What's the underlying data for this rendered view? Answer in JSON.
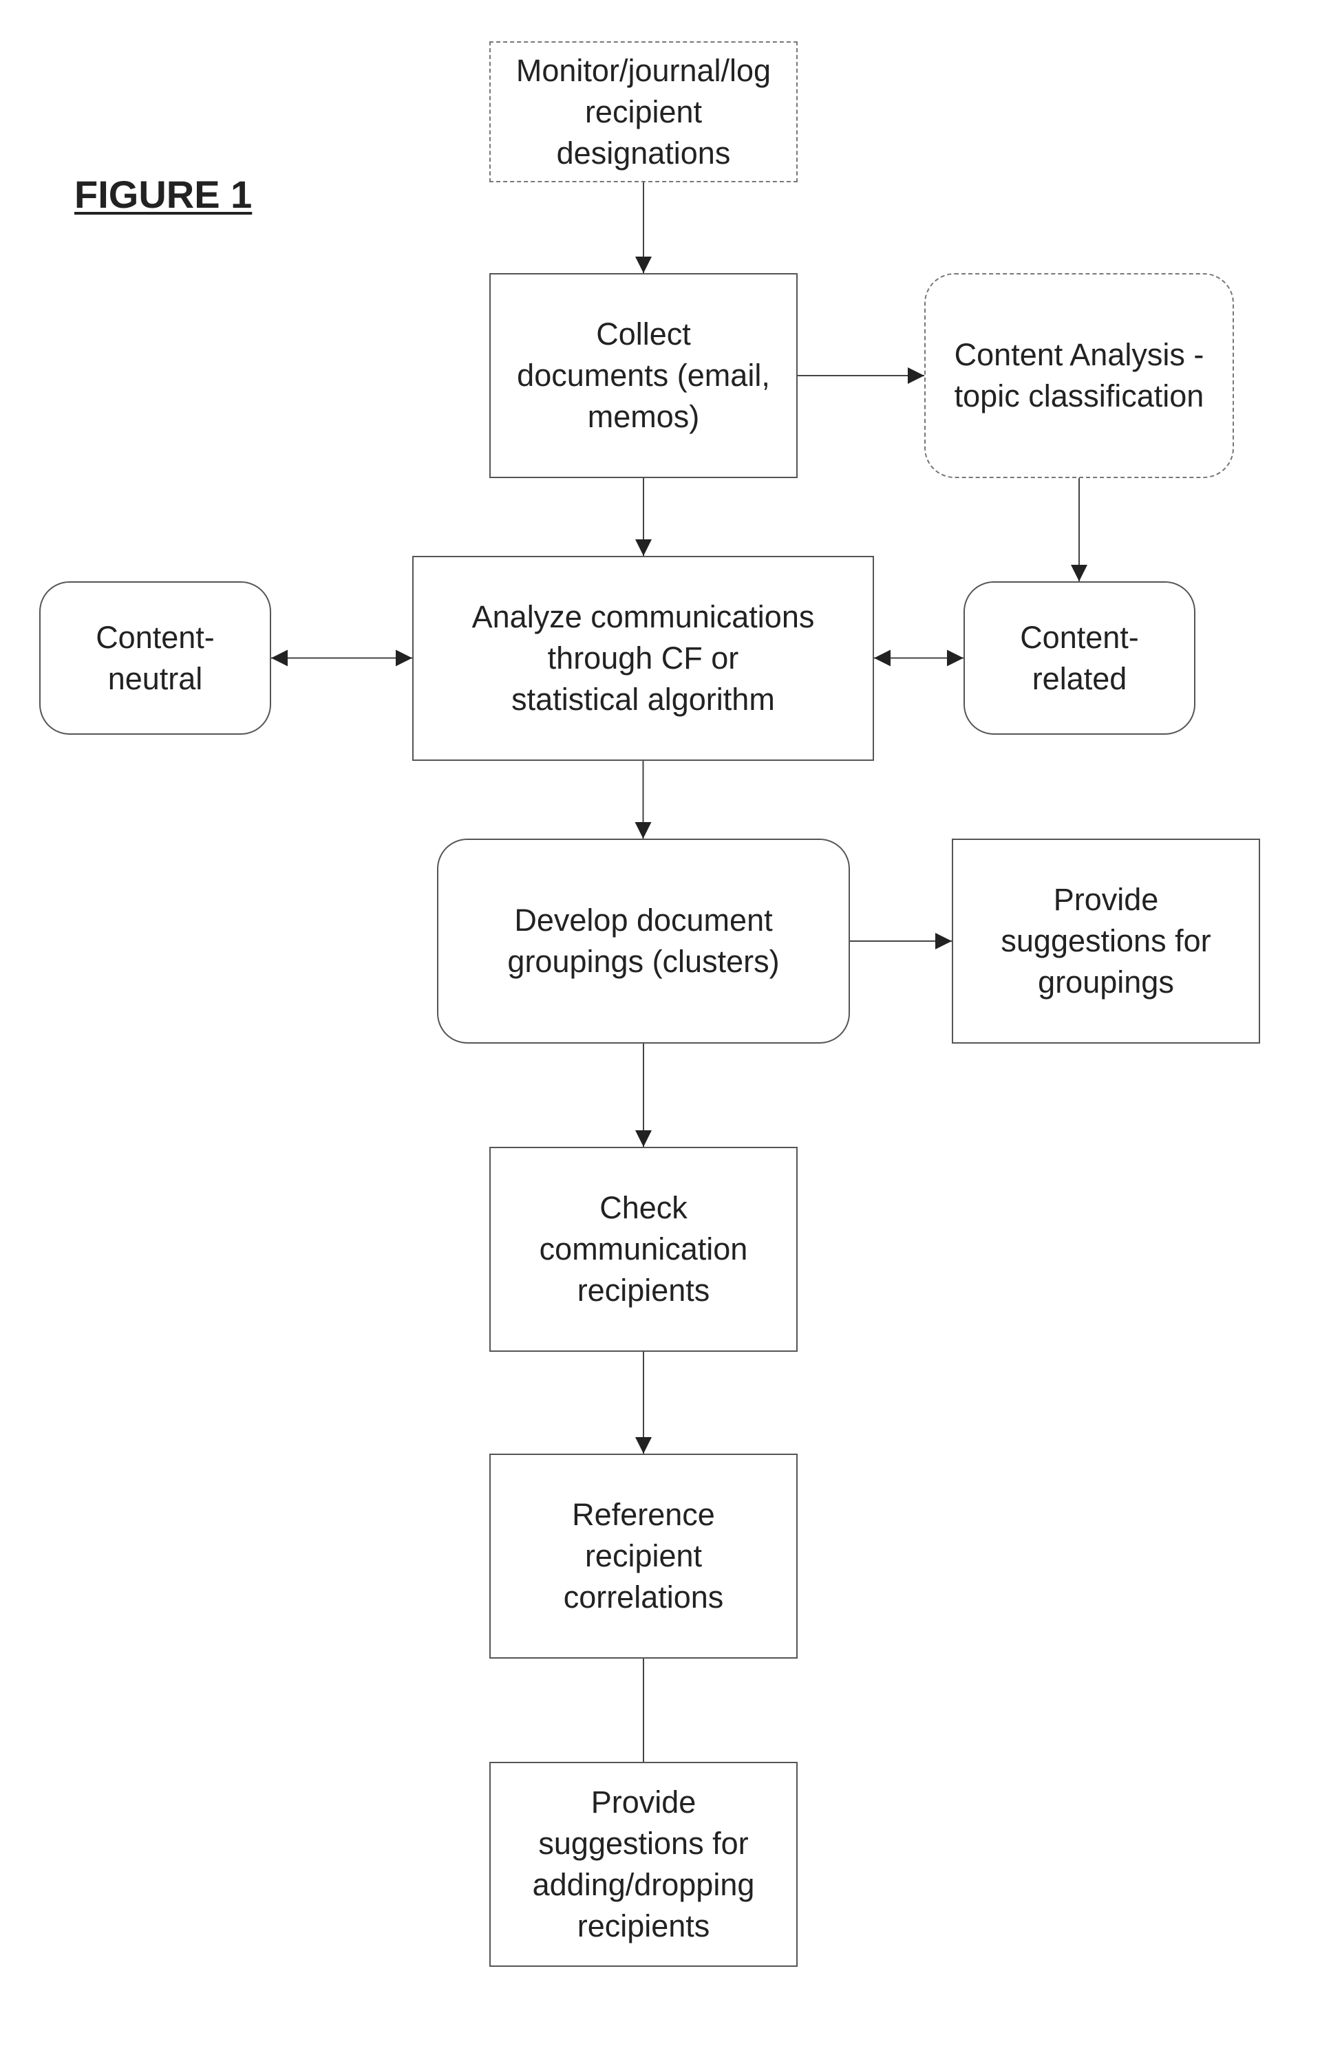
{
  "figure": {
    "title": "FIGURE 1"
  },
  "nodes": {
    "monitor": {
      "label": "Monitor/journal/log\nrecipient\ndesignations",
      "style": "dashed"
    },
    "collect": {
      "label": "Collect\ndocuments (email,\nmemos)",
      "style": "solid"
    },
    "content_analysis": {
      "label": "Content Analysis -\ntopic classification",
      "style": "dashed-rounded"
    },
    "content_neutral": {
      "label": "Content-\nneutral",
      "style": "rounded"
    },
    "analyze": {
      "label": "Analyze communications\nthrough CF or\nstatistical algorithm",
      "style": "solid"
    },
    "content_related": {
      "label": "Content-\nrelated",
      "style": "rounded"
    },
    "develop": {
      "label": "Develop document\ngroupings (clusters)",
      "style": "rounded"
    },
    "provide_groupings": {
      "label": "Provide\nsuggestions for\ngroupings",
      "style": "solid"
    },
    "check": {
      "label": "Check\ncommunication\nrecipients",
      "style": "solid"
    },
    "reference": {
      "label": "Reference\nrecipient\ncorrelations",
      "style": "solid"
    },
    "provide_recipients": {
      "label": "Provide\nsuggestions for\nadding/dropping\nrecipients",
      "style": "solid"
    }
  },
  "edges": [
    {
      "from": "monitor",
      "to": "collect",
      "type": "arrow"
    },
    {
      "from": "collect",
      "to": "content_analysis",
      "type": "arrow"
    },
    {
      "from": "collect",
      "to": "analyze",
      "type": "arrow"
    },
    {
      "from": "content_analysis",
      "to": "content_related",
      "type": "arrow"
    },
    {
      "from": "content_neutral",
      "to": "analyze",
      "type": "bidirectional"
    },
    {
      "from": "analyze",
      "to": "content_related",
      "type": "bidirectional"
    },
    {
      "from": "analyze",
      "to": "develop",
      "type": "arrow"
    },
    {
      "from": "develop",
      "to": "provide_groupings",
      "type": "arrow"
    },
    {
      "from": "develop",
      "to": "check",
      "type": "arrow"
    },
    {
      "from": "check",
      "to": "reference",
      "type": "arrow"
    },
    {
      "from": "reference",
      "to": "provide_recipients",
      "type": "line"
    }
  ]
}
